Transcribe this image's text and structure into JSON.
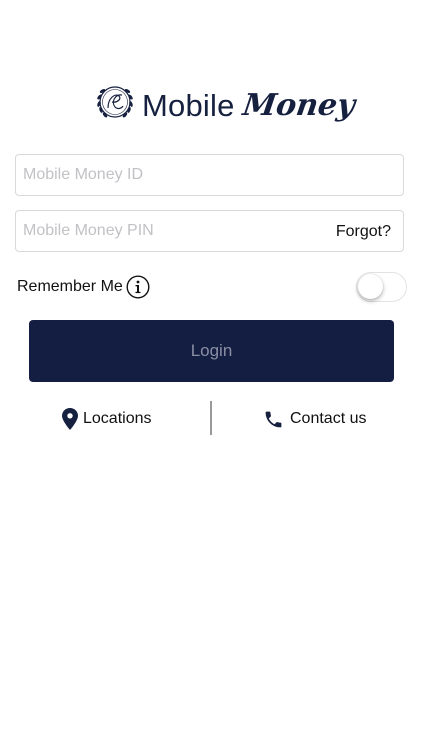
{
  "brand": {
    "wordmark": "Mobile",
    "script": "Money",
    "color": "#16203f"
  },
  "login_form": {
    "id_field": {
      "placeholder": "Mobile Money ID",
      "value": ""
    },
    "pin_field": {
      "placeholder": "Mobile Money PIN",
      "value": ""
    },
    "forgot_label": "Forgot?",
    "remember_label": "Remember Me",
    "remember_on": false,
    "login_label": "Login",
    "login_bg": "#141e42"
  },
  "footer_links": {
    "locations_label": "Locations",
    "locations_icon": "map-pin-icon",
    "contact_label": "Contact us",
    "contact_icon": "phone-icon"
  }
}
